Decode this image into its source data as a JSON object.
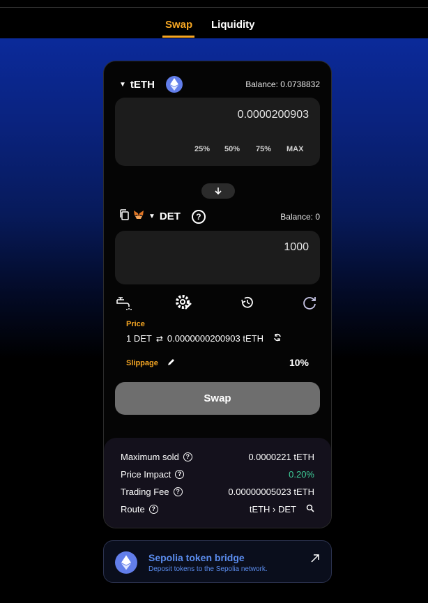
{
  "nav": {
    "tabs": [
      {
        "label": "Swap"
      },
      {
        "label": "Liquidity"
      }
    ]
  },
  "from": {
    "token": "tETH",
    "balance": "Balance: 0.0738832",
    "amount": "0.0000200903",
    "pcts": [
      "25%",
      "50%",
      "75%",
      "MAX"
    ]
  },
  "to": {
    "token": "DET",
    "balance": "Balance: 0",
    "amount": "1000"
  },
  "price": {
    "label": "Price",
    "left": "1 DET",
    "right": "0.0000000200903 tETH"
  },
  "slippage": {
    "label": "Slippage",
    "value": "10%"
  },
  "swap_button": "Swap",
  "details": {
    "rows": [
      {
        "label": "Maximum sold",
        "value": "0.0000221 tETH",
        "value_color": "#ffffff"
      },
      {
        "label": "Price Impact",
        "value": "0.20%",
        "value_color": "#3ecf9a"
      },
      {
        "label": "Trading Fee",
        "value": "0.00000005023 tETH",
        "value_color": "#ffffff"
      },
      {
        "label": "Route",
        "value": "tETH › DET",
        "value_color": "#ffffff"
      }
    ]
  },
  "bridge": {
    "title": "Sepolia token bridge",
    "subtitle": "Deposit tokens to the Sepolia network."
  },
  "colors": {
    "accent": "#f5a623",
    "positive": "#3ecf9a",
    "link": "#5b8def"
  }
}
